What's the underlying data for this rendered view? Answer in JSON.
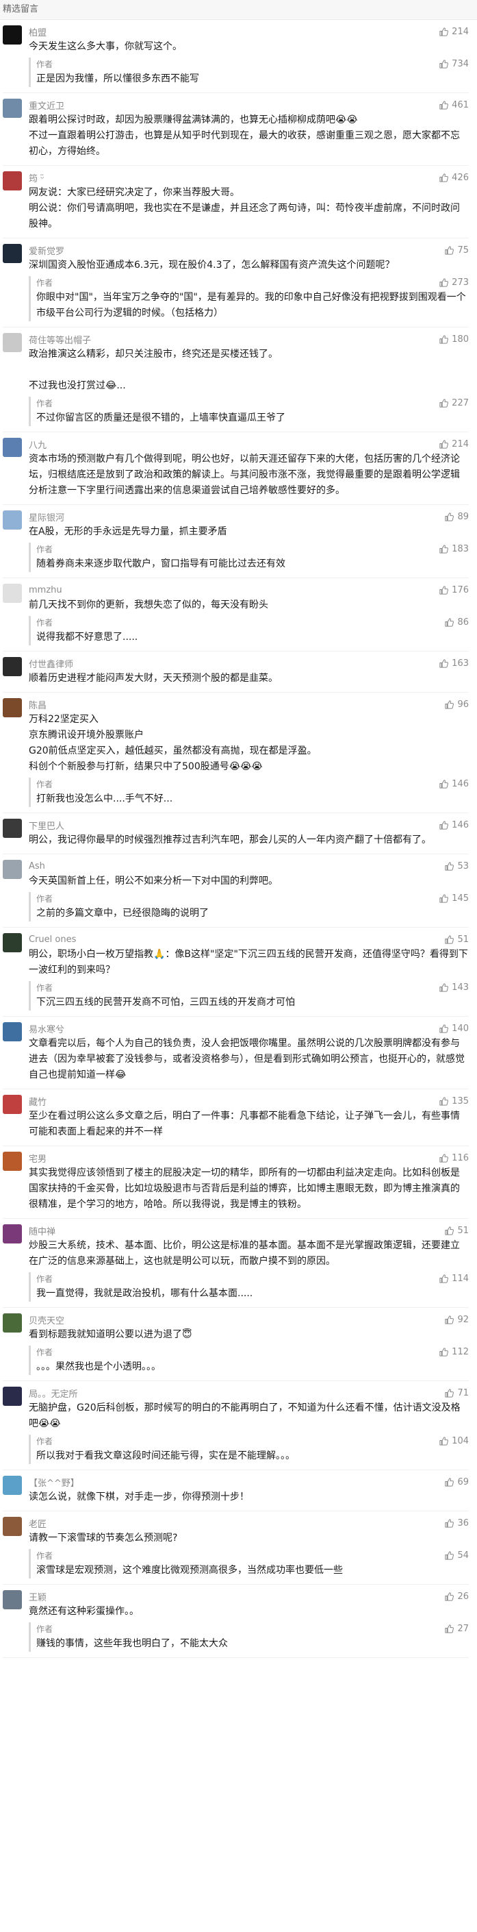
{
  "header": {
    "title": "精选留言"
  },
  "author_label": "作者",
  "comments": [
    {
      "nick": "柏盟",
      "likes": "214",
      "avatar_color": "#111111",
      "text": "今天发生这么多大事，你就写这个。",
      "reply": "正是因为我懂，所以懂很多东西不能写",
      "reply_likes": "734"
    },
    {
      "nick": "重文近卫",
      "likes": "461",
      "avatar_color": "#6f8ba8",
      "text": "跟着明公探讨时政，却因为股票赚得盆满钵满的，也算无心插柳柳成荫吧😭😭\n不过一直跟着明公打游击，也算是从知乎时代到现在，最大的收获，感谢重重三观之恩，愿大家都不忘初心，方得始终。",
      "reply": "",
      "reply_likes": ""
    },
    {
      "nick": "筠 ᵕ̈",
      "likes": "426",
      "avatar_color": "#b13a3a",
      "text": "网友说：大家已经研究决定了，你来当荐股大哥。\n明公说：你们号请高明吧，我也实在不是谦虚，并且还念了两句诗，叫：苟怜夜半虚前席，不问时政问股神。",
      "reply": "",
      "reply_likes": ""
    },
    {
      "nick": "爱新觉罗",
      "likes": "75",
      "avatar_color": "#1e2a3a",
      "text": "深圳国资入股怡亚通成本6.3元，现在股价4.3了，怎么解释国有资产流失这个问题呢？",
      "reply": "你眼中对\"国\"，当年宝万之争夺的\"国\"，是有差异的。我的印象中自己好像没有把视野拔到围观看一个市级平台公司行为逻辑的时候。（包括格力）",
      "reply_likes": "273"
    },
    {
      "nick": "荷住等等出帽子",
      "likes": "180",
      "avatar_color": "#c9c9c9",
      "text": "政治推演这么精彩，却只关注股市，终究还是买楼还钱了。\n\n不过我也没打赏过😂...",
      "reply": "不过你留言区的质量还是很不错的，上墙率快直逼瓜王爷了",
      "reply_likes": "227"
    },
    {
      "nick": "八九",
      "likes": "214",
      "avatar_color": "#5a7fb0",
      "text": "资本市场的预测散户有几个做得到呢，明公也好，以前天涯还留存下来的大佬，包括历害的几个经济论坛，归根结底还是放到了政治和政策的解读上。与其问股市涨不涨，我觉得最重要的是跟着明公学逻辑分析注意一下字里行间透露出来的信息渠道尝试自己培养敏感性要好的多。",
      "reply": "",
      "reply_likes": ""
    },
    {
      "nick": "星际银河",
      "likes": "89",
      "avatar_color": "#8fb1d6",
      "text": "在A股，无形的手永远是先导力量，抓主要矛盾",
      "reply": "随着券商未来逐步取代散户，窗口指导有可能比过去还有效",
      "reply_likes": "183"
    },
    {
      "nick": "mmzhu",
      "likes": "176",
      "avatar_color": "#e0e0e0",
      "text": "前几天找不到你的更新，我想失恋了似的，每天没有盼头",
      "reply": "说得我都不好意思了.....",
      "reply_likes": "86"
    },
    {
      "nick": "付世鑫律师",
      "likes": "163",
      "avatar_color": "#2b2b2b",
      "text": "顺着历史进程才能闷声发大财，天天预测个股的都是韭菜。",
      "reply": "",
      "reply_likes": ""
    },
    {
      "nick": "陈昌",
      "likes": "96",
      "avatar_color": "#7a4a2a",
      "text": "万科22坚定买入\n京东腾讯设开境外股票账户\nG20前低点坚定买入，越低越买，虽然都没有高抛，现在都是浮盈。\n科创个个新股参与打新，结果只中了500股通号😭😭😭",
      "reply": "打新我也没怎么中....手气不好...",
      "reply_likes": "146"
    },
    {
      "nick": "下里巴人",
      "likes": "146",
      "avatar_color": "#3a3a3a",
      "text": "明公，我记得你最早的时候强烈推荐过吉利汽车吧，那会儿买的人一年内资产翻了十倍都有了。",
      "reply": "",
      "reply_likes": ""
    },
    {
      "nick": "Ash",
      "likes": "53",
      "avatar_color": "#9aa4ae",
      "text": "今天英国新首上任，明公不如来分析一下对中国的利弊吧。",
      "reply": "之前的多篇文章中，已经很隐晦的说明了",
      "reply_likes": "145"
    },
    {
      "nick": "Cruel ones",
      "likes": "51",
      "avatar_color": "#2d3d2d",
      "text": "明公，职场小白一枚万望指教🙏：像B这样\"坚定\"下沉三四五线的民营开发商，还值得坚守吗？看得到下一波红利的到来吗？",
      "reply": "下沉三四五线的民营开发商不可怕，三四五线的开发商才可怕",
      "reply_likes": "143"
    },
    {
      "nick": "易水寒兮",
      "likes": "140",
      "avatar_color": "#3f6fa0",
      "text": "文章看完以后，每个人为自己的钱负责，没人会把饭喂你嘴里。虽然明公说的几次股票明牌都没有参与进去（因为幸早被套了没钱参与，或者没资格参与），但是看到形式确如明公预言，也挺开心的，就感觉自己也提前知道一样😂",
      "reply": "",
      "reply_likes": ""
    },
    {
      "nick": "藏竹",
      "likes": "135",
      "avatar_color": "#c04040",
      "text": "至少在看过明公这么多文章之后，明白了一件事：凡事都不能看急下结论，让子弹飞一会儿，有些事情可能和表面上看起来的并不一样",
      "reply": "",
      "reply_likes": ""
    },
    {
      "nick": "宅男",
      "likes": "116",
      "avatar_color": "#b85a2a",
      "text": "其实我觉得应该领悟到了楼主的屁股决定一切的精华，即所有的一切都由利益决定走向。比如科创板是国家扶持的千金买骨，比如垃圾股退市与否背后是利益的博弈，比如博主惠眼无数，即为博主推演真的很精准，是个学习的地方，哈哈。所以我得说，我是博主的铁粉。",
      "reply": "",
      "reply_likes": ""
    },
    {
      "nick": "随中禅",
      "likes": "51",
      "avatar_color": "#7a3a7a",
      "text": "炒股三大系统，技术、基本面、比价，明公这是标准的基本面。基本面不是光掌握政策逻辑，还要建立在广泛的信息来源基础上，这也就是明公可以玩，而散户摸不到的原因。",
      "reply": "我一直觉得，我就是政治投机，哪有什么基本面.....",
      "reply_likes": "114"
    },
    {
      "nick": "贝壳天空",
      "likes": "92",
      "avatar_color": "#4a6a3a",
      "text": "看到标题我就知道明公要以进为退了😇",
      "reply": "。。。果然我也是个小透明。。。",
      "reply_likes": "112"
    },
    {
      "nick": "局。。无定所",
      "likes": "71",
      "avatar_color": "#2a2a4a",
      "text": "无脑护盘，G20后科创板，那时候写的明白的不能再明白了，不知道为什么还看不懂，估计语文没及格吧😭😭",
      "reply": "所以我对于看我文章这段时间还能亏得，实在是不能理解。。。",
      "reply_likes": "104"
    },
    {
      "nick": "【张^^野】",
      "likes": "69",
      "avatar_color": "#5aa0c8",
      "text": "读怎么说，就像下棋，对手走一步，你得预测十步！",
      "reply": "",
      "reply_likes": ""
    },
    {
      "nick": "老匠",
      "likes": "36",
      "avatar_color": "#8a5a3a",
      "text": "请教一下滚雪球的节奏怎么预测呢?",
      "reply": "滚雪球是宏观预测，这个难度比微观预测高很多，当然成功率也要低一些",
      "reply_likes": "54"
    },
    {
      "nick": "王颖",
      "likes": "26",
      "avatar_color": "#6a7a8a",
      "text": "竟然还有这种彩蛋操作。。",
      "reply": "赚钱的事情，这些年我也明白了，不能太大众",
      "reply_likes": "27"
    }
  ]
}
